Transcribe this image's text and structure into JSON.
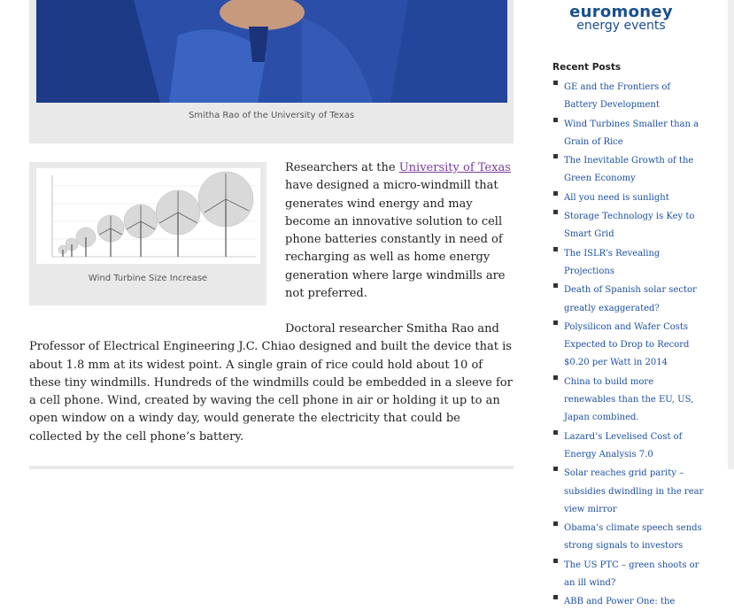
{
  "article": {
    "hero_caption": "Smitha Rao of the University of Texas",
    "figure_caption": "Wind Turbine Size Increase",
    "para1_before_link": "Researchers at the ",
    "para1_link": "University of Texas",
    "para1_after_link": " have designed a micro-windmill that generates wind energy and may become an innovative solution to cell phone batteries constantly in need of recharging as well as home energy generation where large windmills are not preferred.",
    "para2": "Doctoral researcher Smitha Rao and Professor of Electrical Engineering J.C. Chiao designed and built the device that is about 1.8 mm at its widest point. A single grain of rice could hold about 10 of these tiny windmills. Hundreds of the windmills could be embedded in a sleeve for a cell phone. Wind, created by waving the cell phone in air or holding it up to an open window on a windy day, would generate the electricity that could be collected by the cell phone’s battery."
  },
  "sidebar": {
    "logo_line1": "euromoney",
    "logo_line2": "energy events",
    "recent_heading": "Recent Posts",
    "recent_posts": [
      "GE and the Frontiers of Battery Development",
      "Wind Turbines Smaller than a Grain of Rice",
      "The Inevitable Growth of the Green Economy",
      "All you need is sunlight",
      "Storage Technology is Key to Smart Grid",
      "The ISLR’s Revealing Projections",
      "Death of Spanish solar sector greatly exaggerated?",
      "Polysilicon and Wafer Costs Expected to Drop to Record $0.20 per Watt in 2014",
      "China to build more renewables than the EU, US, Japan combined.",
      "Lazard’s Levelised Cost of Energy Analysis 7.0",
      "Solar reaches grid parity – subsidies dwindling in the rear view mirror",
      "Obama’s climate speech sends strong signals to investors",
      "The US PTC – green shoots or an ill wind?",
      "ABB and Power One: the"
    ]
  },
  "colors": {
    "link": "#1b4fa0",
    "visited_link": "#7a3b9a",
    "box_bg": "#e9e9e9",
    "logo": "#1a4f8f"
  }
}
